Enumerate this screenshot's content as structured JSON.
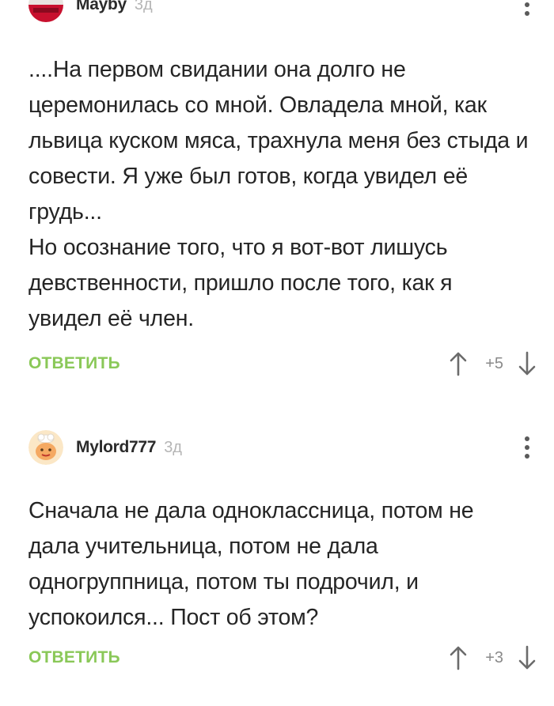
{
  "comments": [
    {
      "username": "Mayby",
      "time": "3д",
      "text": "....На первом свидании она долго не церемонилась со мной. Овладела мной, как львица куском мяса, трахнула меня без стыда и совести. Я уже был готов, когда увидел её грудь...\nНо осознание того, что я вот-вот лишусь девственности, пришло после того, как я увидел её член.",
      "reply_label": "ОТВЕТИТЬ",
      "score": "+5"
    },
    {
      "username": "Mylord777",
      "time": "3д",
      "text": "Сначала не дала одноклассница, потом не дала учительница, потом не дала одногруппница, потом ты подрочил, и успокоился... Пост об этом?",
      "reply_label": "ОТВЕТИТЬ",
      "score": "+3"
    }
  ],
  "colors": {
    "accent_green": "#8ac858",
    "text": "#252525",
    "muted": "#b5b5b5"
  },
  "icons": {
    "more": "more-vertical-icon",
    "upvote": "arrow-up-icon",
    "downvote": "arrow-down-icon"
  }
}
